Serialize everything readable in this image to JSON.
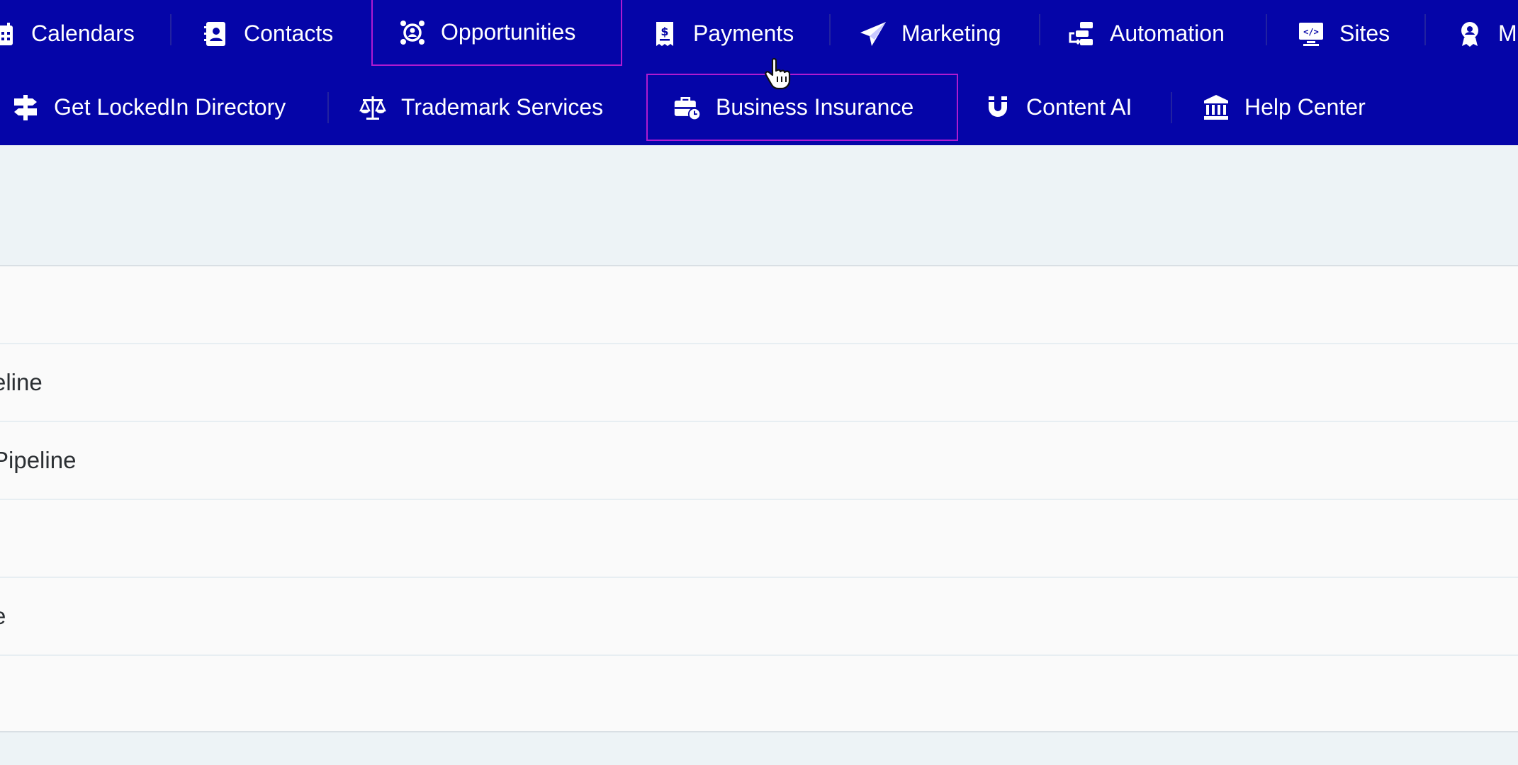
{
  "topnav": {
    "row1": [
      {
        "label": "Calendars",
        "icon": "calendar-icon"
      },
      {
        "label": "Contacts",
        "icon": "contacts-book-icon"
      },
      {
        "label": "Opportunities",
        "icon": "target-user-icon"
      },
      {
        "label": "Payments",
        "icon": "invoice-dollar-icon"
      },
      {
        "label": "Marketing",
        "icon": "paper-plane-icon"
      },
      {
        "label": "Automation",
        "icon": "workflow-icon"
      },
      {
        "label": "Sites",
        "icon": "monitor-code-icon"
      },
      {
        "label": "M",
        "icon": "badge-icon"
      }
    ],
    "row2": [
      {
        "label": "Get LockedIn Directory",
        "icon": "signpost-icon"
      },
      {
        "label": "Trademark Services",
        "icon": "scales-icon"
      },
      {
        "label": "Business Insurance",
        "icon": "briefcase-clock-icon"
      },
      {
        "label": "Content AI",
        "icon": "magnet-icon"
      },
      {
        "label": "Help Center",
        "icon": "bank-icon"
      }
    ]
  },
  "list": {
    "rows": [
      "",
      "eline",
      "Pipeline",
      "",
      "e",
      ""
    ]
  },
  "colors": {
    "nav_bg": "#0505a8",
    "nav_text": "#ffffff",
    "highlight_border": "#b01ad0",
    "page_bg": "#edf3f6",
    "card_bg": "#fafafa"
  }
}
